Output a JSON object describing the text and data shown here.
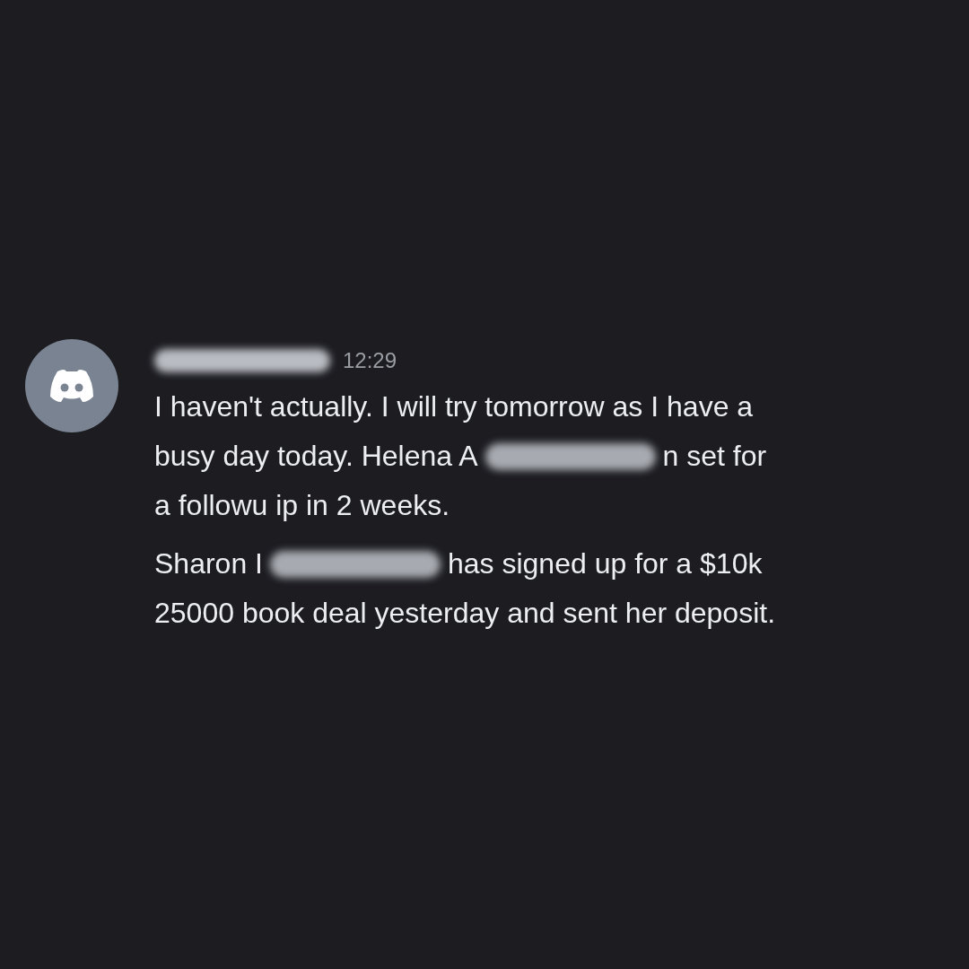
{
  "message": {
    "author": {
      "kind": "redacted"
    },
    "time": "12:29",
    "paragraphs": [
      {
        "lines": [
          [
            {
              "kind": "text",
              "text": "I haven't actually. I will try tomorrow as I have a"
            }
          ],
          [
            {
              "kind": "text",
              "text": "busy day today. Helena A"
            },
            {
              "kind": "redacted"
            },
            {
              "kind": "text",
              "text": "n set for"
            }
          ],
          [
            {
              "kind": "text",
              "text": "a followu ip in 2 weeks."
            }
          ]
        ]
      },
      {
        "lines": [
          [
            {
              "kind": "text",
              "text": "Sharon I"
            },
            {
              "kind": "redacted"
            },
            {
              "kind": "text",
              "text": "has signed up for a $10k"
            }
          ],
          [
            {
              "kind": "text",
              "text": "25000 book deal yesterday and sent her deposit."
            }
          ]
        ]
      }
    ]
  }
}
